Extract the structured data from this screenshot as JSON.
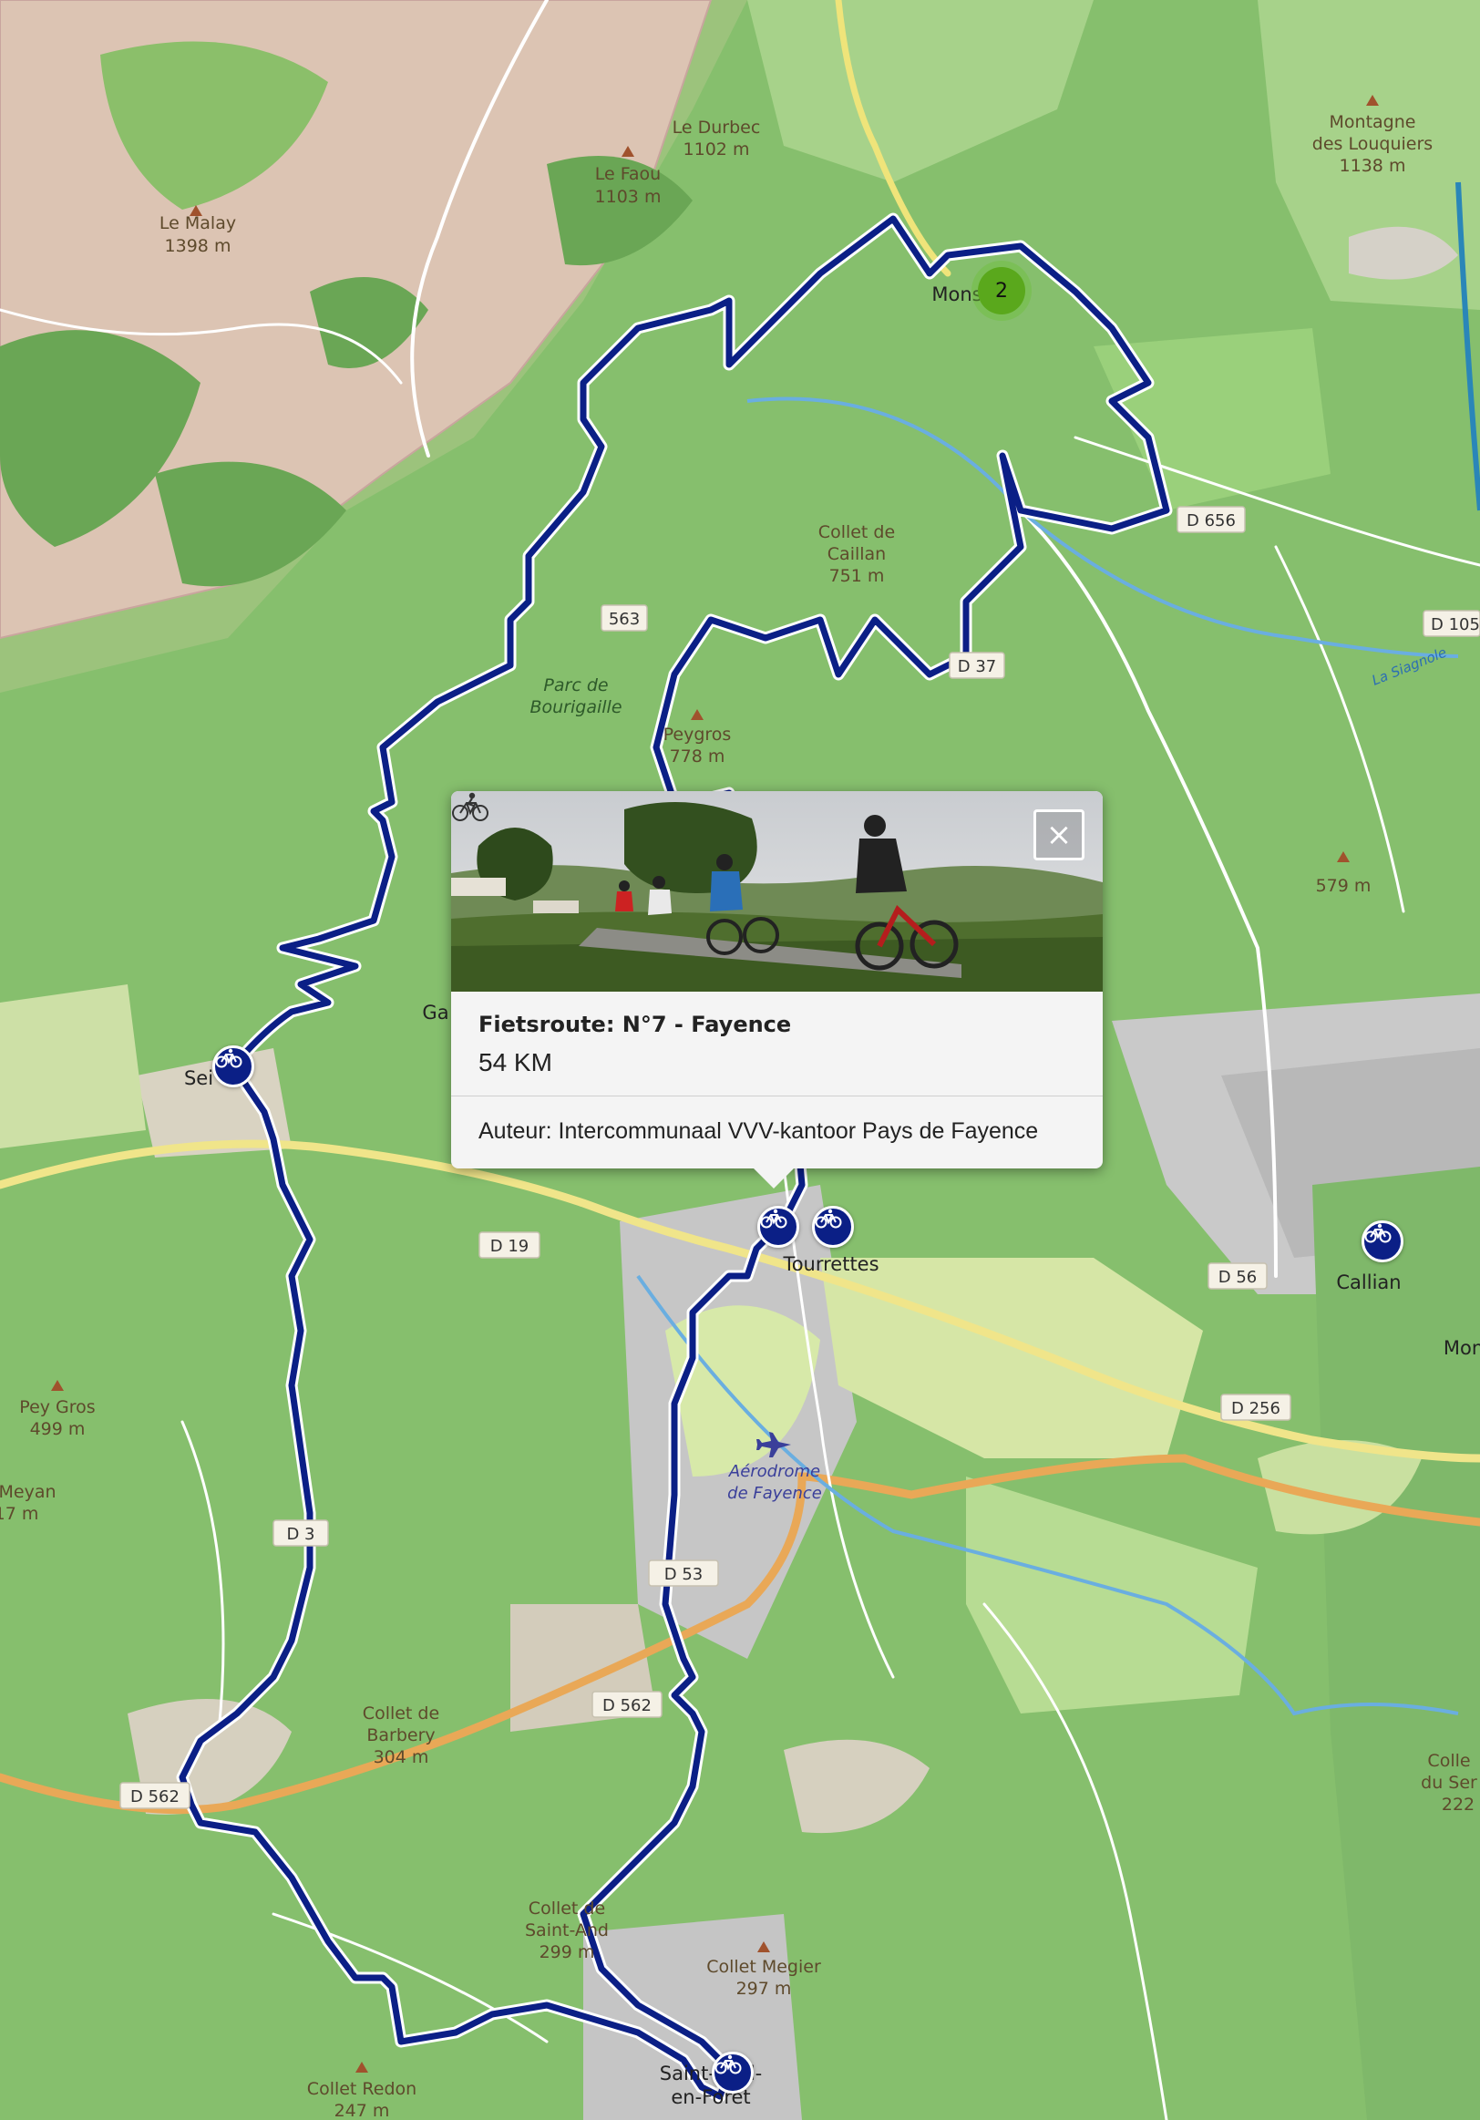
{
  "map": {
    "peaks": [
      {
        "name": "Le Malay",
        "elev": "1398 m"
      },
      {
        "name": "Le Faou",
        "elev": "1103 m"
      },
      {
        "name": "Le Durbec",
        "elev": "1102 m"
      },
      {
        "name": "Montagne",
        "elev": "des Louquiers",
        "elev2": "1138 m"
      },
      {
        "name": "Collet de",
        "elev": "Caillan",
        "elev2": "751 m"
      },
      {
        "name": "Peygros",
        "elev": "778 m"
      },
      {
        "name": "",
        "elev": "579 m"
      },
      {
        "name": "Pey Gros",
        "elev": "499 m"
      },
      {
        "name": "Meyan",
        "elev": "17 m"
      },
      {
        "name": "Collet de",
        "elev": "Barbery",
        "elev2": "304 m"
      },
      {
        "name": "Collet de",
        "elev": "Saint-And",
        "elev2": "299 m"
      },
      {
        "name": "Collet Megier",
        "elev": "297 m"
      },
      {
        "name": "Collet Redon",
        "elev": "247 m"
      },
      {
        "name": "Colle",
        "elev": "du Ser",
        "elev2": "222"
      }
    ],
    "towns": [
      "Mons",
      "Sei",
      "Tourrettes",
      "Callian",
      "Mon",
      "Saint-Paul-",
      "en-Forêt",
      "Ga"
    ],
    "park": [
      "Parc de",
      "Bourigaille"
    ],
    "aerodrome": [
      "Aérodrome",
      "de Fayence"
    ],
    "river": "La Siagnole",
    "roads": [
      "563",
      "D 656",
      "D 19",
      "D 56",
      "D 256",
      "D 562",
      "D 562",
      "D 53",
      "D 53",
      "D 105",
      "D 37",
      "D 3"
    ],
    "cluster_count": "2"
  },
  "popup": {
    "title": "Fietsroute: N°7 - Fayence",
    "distance": "54 KM",
    "author": "Auteur: Intercommunaal VVV-kantoor Pays de Fayence",
    "close_label": "×",
    "distance_icon": "bicycle-icon"
  },
  "markers_icon": "bicycle-icon",
  "colors": {
    "route": "#0b1f86",
    "marker": "#0b1f86",
    "cluster": "#5aa81c"
  }
}
